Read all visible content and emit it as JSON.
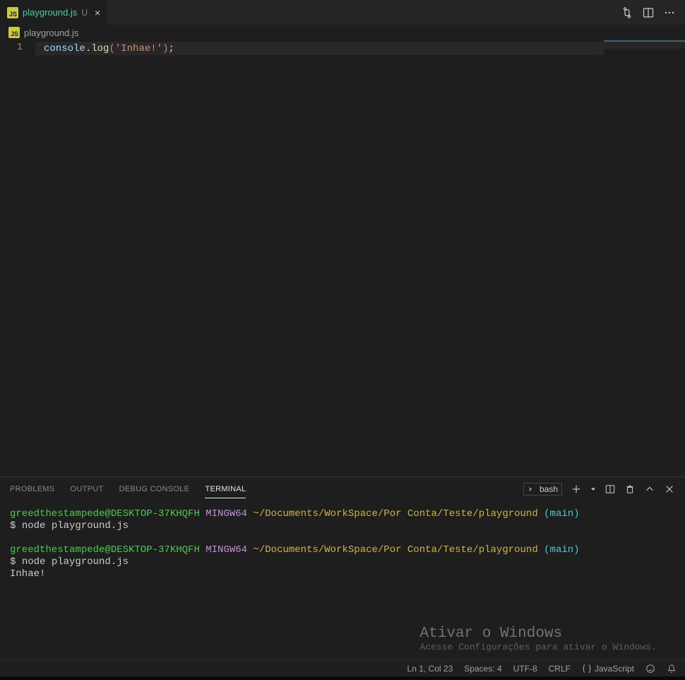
{
  "tab": {
    "filename": "playground.js",
    "modified_indicator": "U",
    "icon_label": "JS"
  },
  "breadcrumb": {
    "filename": "playground.js",
    "icon_label": "JS"
  },
  "editor": {
    "line_number": "1",
    "tok_obj": "console",
    "tok_dot": ".",
    "tok_func": "log",
    "tok_lparen": "(",
    "tok_str": "'Inhae!'",
    "tok_rparen": ")",
    "tok_semi": ";"
  },
  "panel": {
    "tabs": {
      "problems": "PROBLEMS",
      "output": "OUTPUT",
      "debug_console": "DEBUG CONSOLE",
      "terminal": "TERMINAL"
    },
    "terminal_select": "bash"
  },
  "terminal": {
    "user_host": "greedthestampede@DESKTOP-37KHQFH",
    "system": "MINGW64",
    "path": "~/Documents/WorkSpace/Por Conta/Teste/playground",
    "branch_open": "(",
    "branch": "main",
    "branch_close": ")",
    "prompt": "$",
    "cmd1": "node playground.js",
    "cmd2": "node playground.js",
    "output": "Inhae!"
  },
  "watermark": {
    "title": "Ativar o Windows",
    "sub": "Acesse Configurações para ativar o Windows."
  },
  "status": {
    "position": "Ln 1, Col 23",
    "spaces": "Spaces: 4",
    "encoding": "UTF-8",
    "eol": "CRLF",
    "language": "JavaScript"
  }
}
